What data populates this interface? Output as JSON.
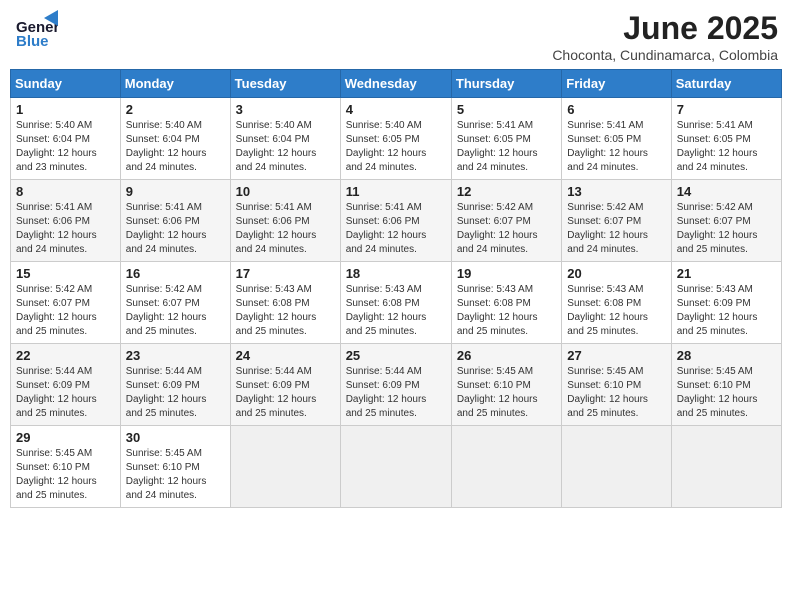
{
  "logo": {
    "line1": "General",
    "line2": "Blue",
    "tagline": ""
  },
  "header": {
    "month": "June 2025",
    "location": "Choconta, Cundinamarca, Colombia"
  },
  "weekdays": [
    "Sunday",
    "Monday",
    "Tuesday",
    "Wednesday",
    "Thursday",
    "Friday",
    "Saturday"
  ],
  "weeks": [
    [
      {
        "day": "1",
        "sunrise": "5:40 AM",
        "sunset": "6:04 PM",
        "daylight": "12 hours and 23 minutes."
      },
      {
        "day": "2",
        "sunrise": "5:40 AM",
        "sunset": "6:04 PM",
        "daylight": "12 hours and 24 minutes."
      },
      {
        "day": "3",
        "sunrise": "5:40 AM",
        "sunset": "6:04 PM",
        "daylight": "12 hours and 24 minutes."
      },
      {
        "day": "4",
        "sunrise": "5:40 AM",
        "sunset": "6:05 PM",
        "daylight": "12 hours and 24 minutes."
      },
      {
        "day": "5",
        "sunrise": "5:41 AM",
        "sunset": "6:05 PM",
        "daylight": "12 hours and 24 minutes."
      },
      {
        "day": "6",
        "sunrise": "5:41 AM",
        "sunset": "6:05 PM",
        "daylight": "12 hours and 24 minutes."
      },
      {
        "day": "7",
        "sunrise": "5:41 AM",
        "sunset": "6:05 PM",
        "daylight": "12 hours and 24 minutes."
      }
    ],
    [
      {
        "day": "8",
        "sunrise": "5:41 AM",
        "sunset": "6:06 PM",
        "daylight": "12 hours and 24 minutes."
      },
      {
        "day": "9",
        "sunrise": "5:41 AM",
        "sunset": "6:06 PM",
        "daylight": "12 hours and 24 minutes."
      },
      {
        "day": "10",
        "sunrise": "5:41 AM",
        "sunset": "6:06 PM",
        "daylight": "12 hours and 24 minutes."
      },
      {
        "day": "11",
        "sunrise": "5:41 AM",
        "sunset": "6:06 PM",
        "daylight": "12 hours and 24 minutes."
      },
      {
        "day": "12",
        "sunrise": "5:42 AM",
        "sunset": "6:07 PM",
        "daylight": "12 hours and 24 minutes."
      },
      {
        "day": "13",
        "sunrise": "5:42 AM",
        "sunset": "6:07 PM",
        "daylight": "12 hours and 24 minutes."
      },
      {
        "day": "14",
        "sunrise": "5:42 AM",
        "sunset": "6:07 PM",
        "daylight": "12 hours and 25 minutes."
      }
    ],
    [
      {
        "day": "15",
        "sunrise": "5:42 AM",
        "sunset": "6:07 PM",
        "daylight": "12 hours and 25 minutes."
      },
      {
        "day": "16",
        "sunrise": "5:42 AM",
        "sunset": "6:07 PM",
        "daylight": "12 hours and 25 minutes."
      },
      {
        "day": "17",
        "sunrise": "5:43 AM",
        "sunset": "6:08 PM",
        "daylight": "12 hours and 25 minutes."
      },
      {
        "day": "18",
        "sunrise": "5:43 AM",
        "sunset": "6:08 PM",
        "daylight": "12 hours and 25 minutes."
      },
      {
        "day": "19",
        "sunrise": "5:43 AM",
        "sunset": "6:08 PM",
        "daylight": "12 hours and 25 minutes."
      },
      {
        "day": "20",
        "sunrise": "5:43 AM",
        "sunset": "6:08 PM",
        "daylight": "12 hours and 25 minutes."
      },
      {
        "day": "21",
        "sunrise": "5:43 AM",
        "sunset": "6:09 PM",
        "daylight": "12 hours and 25 minutes."
      }
    ],
    [
      {
        "day": "22",
        "sunrise": "5:44 AM",
        "sunset": "6:09 PM",
        "daylight": "12 hours and 25 minutes."
      },
      {
        "day": "23",
        "sunrise": "5:44 AM",
        "sunset": "6:09 PM",
        "daylight": "12 hours and 25 minutes."
      },
      {
        "day": "24",
        "sunrise": "5:44 AM",
        "sunset": "6:09 PM",
        "daylight": "12 hours and 25 minutes."
      },
      {
        "day": "25",
        "sunrise": "5:44 AM",
        "sunset": "6:09 PM",
        "daylight": "12 hours and 25 minutes."
      },
      {
        "day": "26",
        "sunrise": "5:45 AM",
        "sunset": "6:10 PM",
        "daylight": "12 hours and 25 minutes."
      },
      {
        "day": "27",
        "sunrise": "5:45 AM",
        "sunset": "6:10 PM",
        "daylight": "12 hours and 25 minutes."
      },
      {
        "day": "28",
        "sunrise": "5:45 AM",
        "sunset": "6:10 PM",
        "daylight": "12 hours and 25 minutes."
      }
    ],
    [
      {
        "day": "29",
        "sunrise": "5:45 AM",
        "sunset": "6:10 PM",
        "daylight": "12 hours and 25 minutes."
      },
      {
        "day": "30",
        "sunrise": "5:45 AM",
        "sunset": "6:10 PM",
        "daylight": "12 hours and 24 minutes."
      },
      null,
      null,
      null,
      null,
      null
    ]
  ],
  "labels": {
    "sunrise": "Sunrise:",
    "sunset": "Sunset:",
    "daylight": "Daylight:"
  }
}
